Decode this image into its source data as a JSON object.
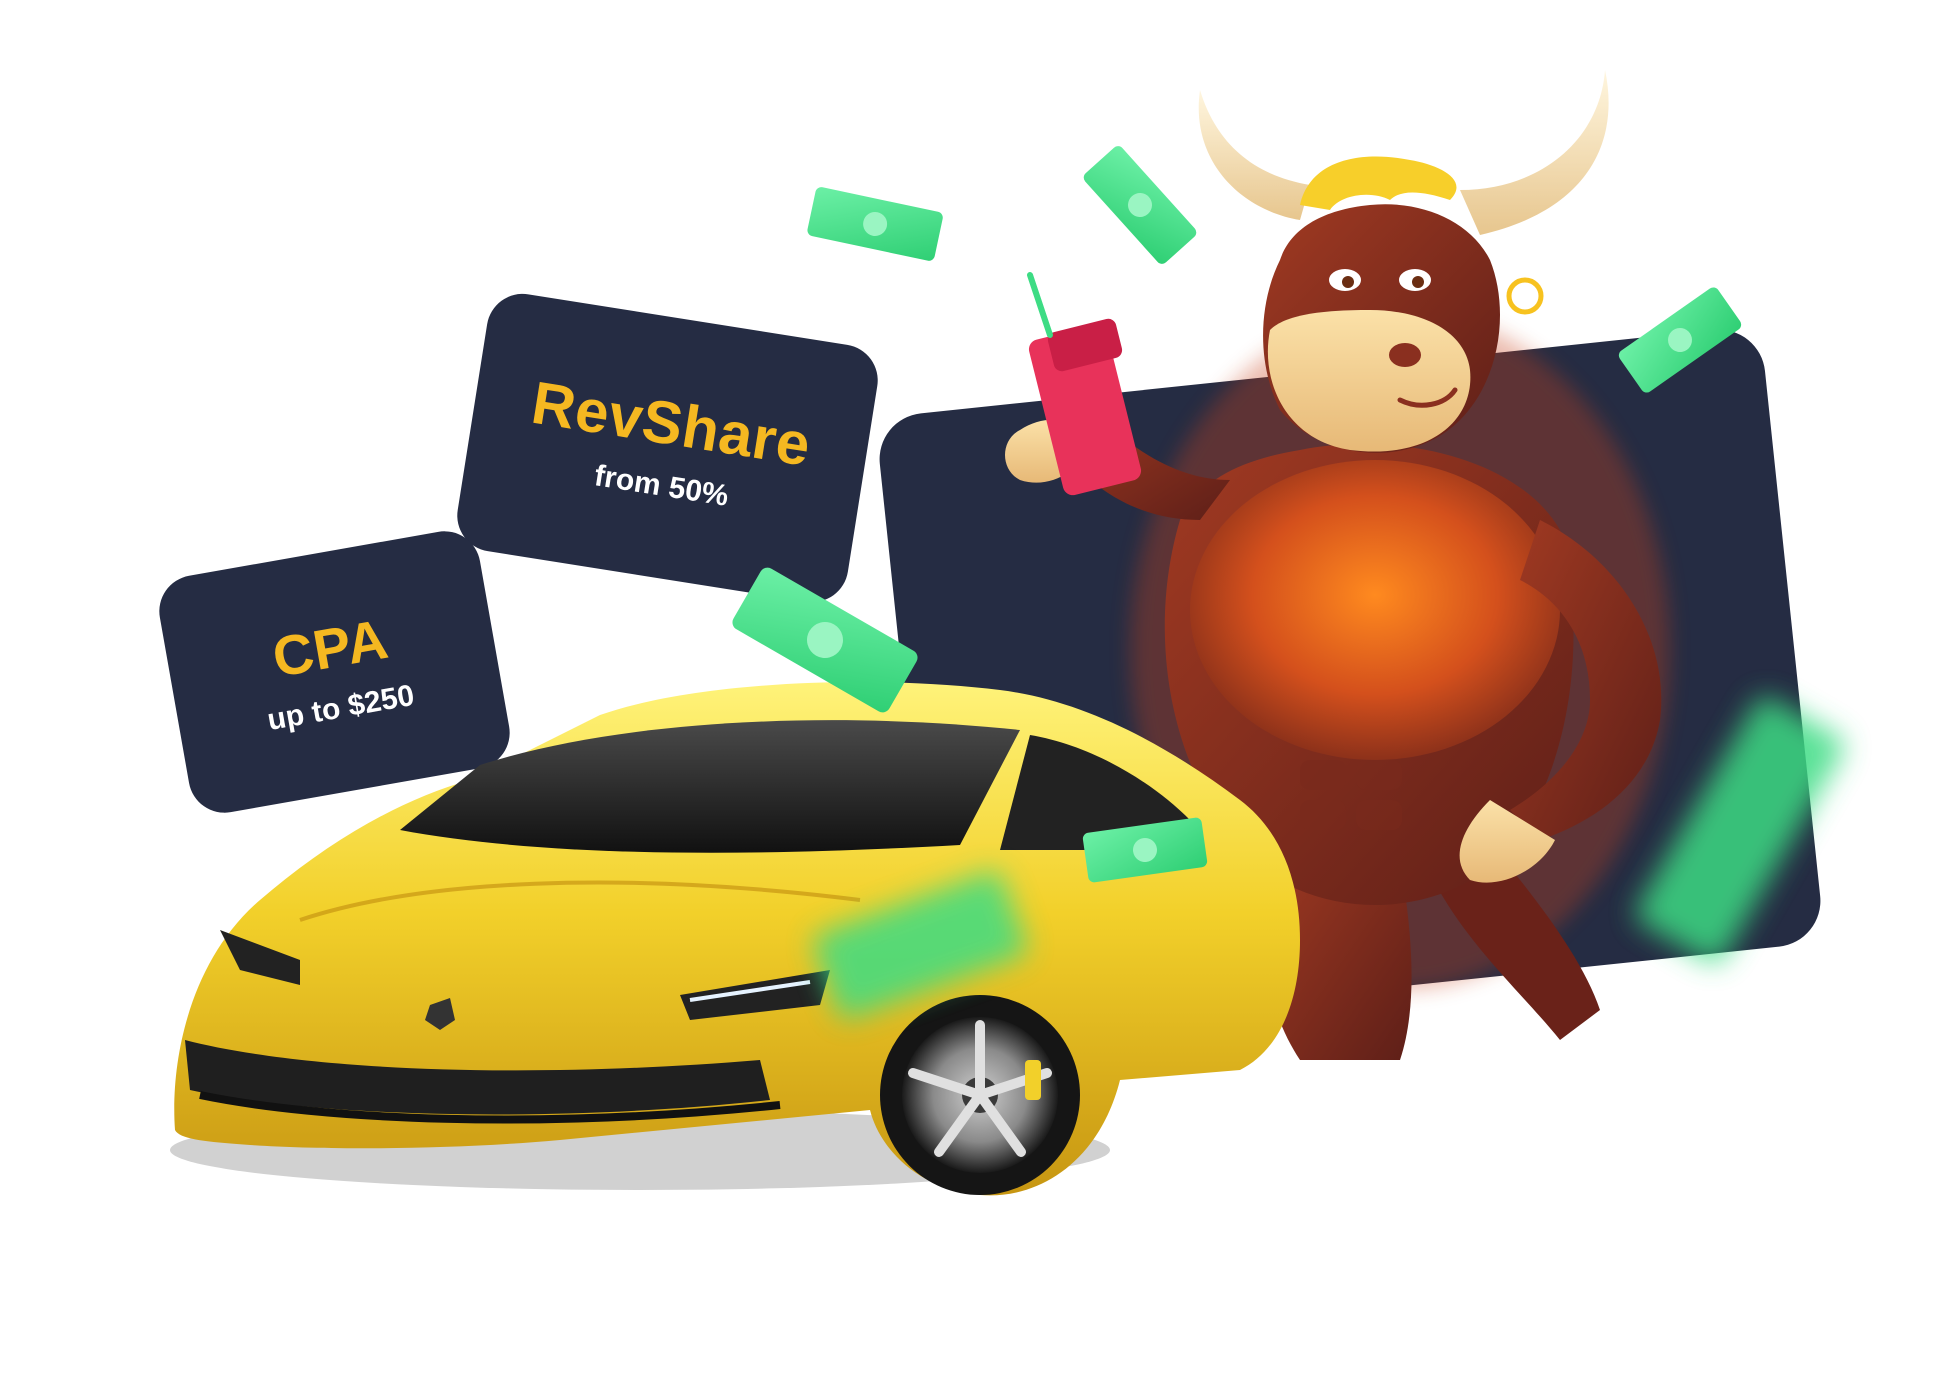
{
  "promo": {
    "revshare": {
      "title": "RevShare",
      "subtitle": "from 50%"
    },
    "cpa": {
      "title": "CPA",
      "subtitle": "up to $250"
    }
  },
  "illustration": {
    "mascot": "bull-mascot",
    "vehicle": "yellow-sports-car",
    "props": [
      "money-gun-icon",
      "banknote-icon"
    ]
  },
  "colors": {
    "card_bg": "#252c43",
    "accent_yellow": "#f5b821",
    "text_white": "#ffffff",
    "banknote_green": "#3ddc84",
    "car_yellow": "#f2d02a",
    "bull_brown": "#8a2f1f"
  }
}
